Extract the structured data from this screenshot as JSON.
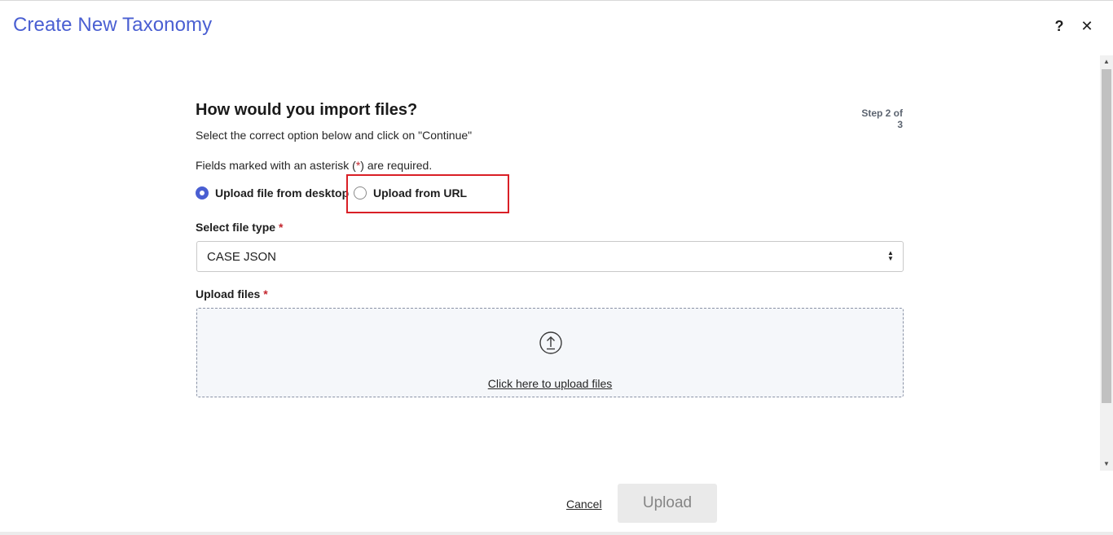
{
  "header": {
    "title": "Create New Taxonomy",
    "help_label": "?",
    "close_label": "✕"
  },
  "step": {
    "heading": "How would you import files?",
    "indicator": "Step 2 of 3",
    "instruction": "Select the correct option below and click on \"Continue\"",
    "required_note_prefix": "Fields marked with an asterisk (",
    "required_note_asterisk": "*",
    "required_note_suffix": ") are required."
  },
  "import_options": [
    {
      "label": "Upload file from desktop",
      "selected": true
    },
    {
      "label": "Upload from URL",
      "selected": false
    }
  ],
  "file_type": {
    "label": "Select file type",
    "required_mark": "*",
    "selected_value": "CASE JSON"
  },
  "upload": {
    "label": "Upload files",
    "required_mark": "*",
    "dropzone_link": "Click here to upload files",
    "icon": "upload-arrow-icon"
  },
  "footer": {
    "cancel_label": "Cancel",
    "upload_label": "Upload"
  },
  "colors": {
    "accent": "#4a5fd2",
    "highlight": "#d91f26",
    "required": "#c4262e"
  }
}
